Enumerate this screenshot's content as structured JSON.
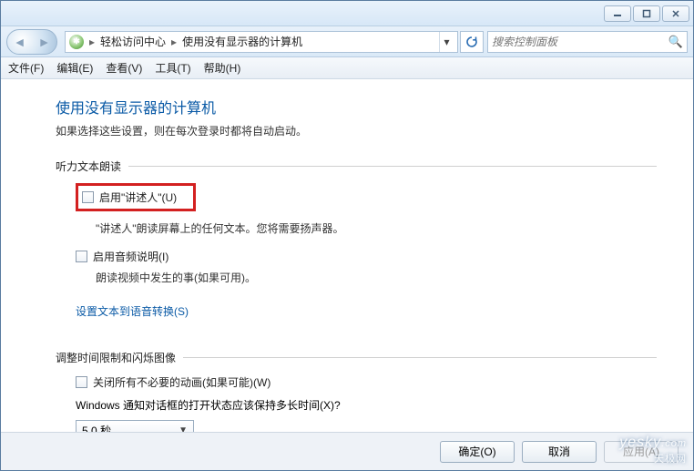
{
  "breadcrumb": {
    "seg1": "轻松访问中心",
    "seg2": "使用没有显示器的计算机"
  },
  "search": {
    "placeholder": "搜索控制面板"
  },
  "menu": {
    "file": "文件(F)",
    "edit": "编辑(E)",
    "view": "查看(V)",
    "tools": "工具(T)",
    "help": "帮助(H)"
  },
  "page": {
    "title": "使用没有显示器的计算机",
    "subtitle": "如果选择这些设置，则在每次登录时都将自动启动。"
  },
  "group1": {
    "label": "听力文本朗读",
    "narrator": "启用\"讲述人\"(U)",
    "narrator_desc": "\"讲述人\"朗读屏幕上的任何文本。您将需要扬声器。",
    "audio": "启用音频说明(I)",
    "audio_desc": "朗读视频中发生的事(如果可用)。",
    "tts_link": "设置文本到语音转换(S)"
  },
  "group2": {
    "label": "调整时间限制和闪烁图像",
    "anim": "关闭所有不必要的动画(如果可能)(W)",
    "question": "Windows 通知对话框的打开状态应该保持多长时间(X)?",
    "duration": "5.0 秒"
  },
  "footer": {
    "ok": "确定(O)",
    "cancel": "取消",
    "apply": "应用(A)"
  },
  "watermark": {
    "en": "yesky",
    "suffix": ".com",
    "cn": "天极网"
  }
}
